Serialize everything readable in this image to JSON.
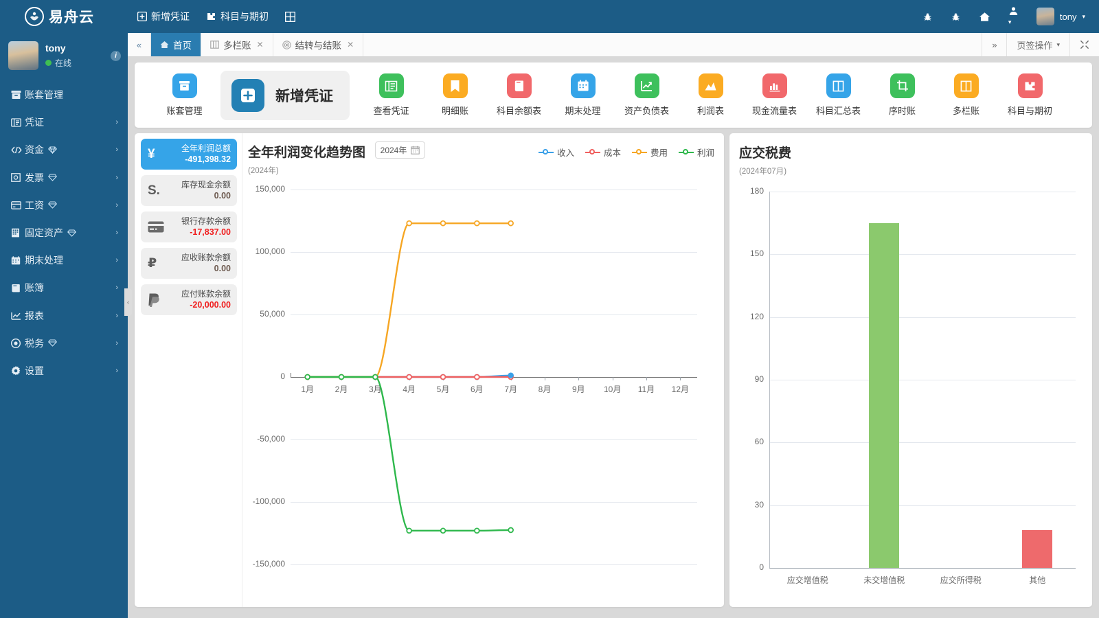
{
  "app": {
    "brand": "易舟云",
    "logo_icon": "lotus-logo-icon"
  },
  "topbar": {
    "actions": [
      {
        "label": "新增凭证",
        "icon": "plus-square-icon"
      },
      {
        "label": "科目与期初",
        "icon": "puzzle-icon"
      },
      {
        "label": "",
        "icon": "grid-icon"
      }
    ],
    "right_icons": [
      "bug-icon",
      "bug-alt-icon",
      "home-icon",
      "user-switch-icon"
    ],
    "user": "tony"
  },
  "sidebar": {
    "user": {
      "name": "tony",
      "status": "在线",
      "info_icon": "info-icon",
      "avatar": "user-avatar"
    },
    "items": [
      {
        "label": "账套管理",
        "icon": "archive-icon",
        "arrow": false,
        "gem": false
      },
      {
        "label": "凭证",
        "icon": "voucher-icon",
        "arrow": true,
        "gem": false
      },
      {
        "label": "资金",
        "icon": "funds-icon",
        "arrow": true,
        "gem": true
      },
      {
        "label": "发票",
        "icon": "invoice-icon",
        "arrow": true,
        "gem": true
      },
      {
        "label": "工资",
        "icon": "salary-card-icon",
        "arrow": true,
        "gem": true
      },
      {
        "label": "固定资产",
        "icon": "building-icon",
        "arrow": true,
        "gem": true
      },
      {
        "label": "期末处理",
        "icon": "calendar-icon",
        "arrow": true,
        "gem": false
      },
      {
        "label": "账簿",
        "icon": "book-icon",
        "arrow": true,
        "gem": false
      },
      {
        "label": "报表",
        "icon": "chart-line-icon",
        "arrow": true,
        "gem": false
      },
      {
        "label": "税务",
        "icon": "tax-circle-icon",
        "arrow": true,
        "gem": true
      },
      {
        "label": "设置",
        "icon": "gear-icon",
        "arrow": true,
        "gem": false
      }
    ],
    "collapse_icon": "chevron-left-icon"
  },
  "tabstrip": {
    "nav_prev_icon": "double-chevron-left-icon",
    "tabs": [
      {
        "label": "首页",
        "icon": "home-icon",
        "active": true,
        "closable": false
      },
      {
        "label": "多栏账",
        "icon": "columns-icon",
        "active": false,
        "closable": true
      },
      {
        "label": "结转与结账",
        "icon": "circle-target-icon",
        "active": false,
        "closable": true
      }
    ],
    "nav_next_icon": "double-chevron-right-icon",
    "ops_label": "页签操作",
    "fullscreen_icon": "expand-icon"
  },
  "shortcuts": {
    "primary": {
      "label": "新增凭证",
      "icon": "plus-square-icon",
      "color": "#2380b4"
    },
    "items": [
      {
        "label": "账套管理",
        "icon": "archive-icon",
        "color": "#35a4e8"
      },
      {
        "label": "查看凭证",
        "icon": "voucher-icon",
        "color": "#3ec05c"
      },
      {
        "label": "明细账",
        "icon": "bookmark-icon",
        "color": "#fbab22"
      },
      {
        "label": "科目余额表",
        "icon": "book-red-icon",
        "color": "#f1686b"
      },
      {
        "label": "期末处理",
        "icon": "calendar-icon",
        "color": "#35a4e8"
      },
      {
        "label": "资产负债表",
        "icon": "chart-line-icon",
        "color": "#3ec05c"
      },
      {
        "label": "利润表",
        "icon": "area-chart-icon",
        "color": "#fbab22"
      },
      {
        "label": "现金流量表",
        "icon": "bar-chart-icon",
        "color": "#f1686b"
      },
      {
        "label": "科目汇总表",
        "icon": "columns-icon",
        "color": "#35a4e8"
      },
      {
        "label": "序时账",
        "icon": "crop-icon",
        "color": "#3ec05c"
      },
      {
        "label": "多栏账",
        "icon": "columns-icon",
        "color": "#fbab22"
      },
      {
        "label": "科目与期初",
        "icon": "puzzle-icon",
        "color": "#f1686b"
      }
    ]
  },
  "stats": [
    {
      "title": "全年利润总额",
      "value": "-491,398.32",
      "icon": "yuan-icon",
      "accent": true,
      "negative": true
    },
    {
      "title": "库存现金余额",
      "value": "0.00",
      "icon": "cash-s-icon",
      "accent": false,
      "negative": false
    },
    {
      "title": "银行存款余额",
      "value": "-17,837.00",
      "icon": "credit-card-icon",
      "accent": false,
      "negative": true
    },
    {
      "title": "应收账款余额",
      "value": "0.00",
      "icon": "ruble-icon",
      "accent": false,
      "negative": false
    },
    {
      "title": "应付账款余额",
      "value": "-20,000.00",
      "icon": "paypal-icon",
      "accent": false,
      "negative": true
    }
  ],
  "line_panel": {
    "title": "全年利润变化趋势图",
    "subtitle": "(2024年)",
    "year_value": "2024年",
    "year_icon": "calendar-icon"
  },
  "bar_panel": {
    "title": "应交税费",
    "subtitle": "(2024年07月)"
  },
  "chart_data": [
    {
      "type": "line",
      "title": "全年利润变化趋势图",
      "subtitle": "(2024年)",
      "xlabel": "",
      "ylabel": "",
      "ylim": [
        -150000,
        150000
      ],
      "yticks": [
        150000,
        100000,
        50000,
        0,
        -50000,
        -100000,
        -150000
      ],
      "ytick_labels": [
        "150,000",
        "100,000",
        "50,000",
        "0",
        "-50,000",
        "-100,000",
        "-150,000"
      ],
      "categories": [
        "1月",
        "2月",
        "3月",
        "4月",
        "5月",
        "6月",
        "7月",
        "8月",
        "9月",
        "10月",
        "11月",
        "12月"
      ],
      "grid": true,
      "legend_position": "top-right",
      "series": [
        {
          "name": "收入",
          "color": "#3aa0e8",
          "values": [
            0,
            0,
            0,
            0,
            0,
            0,
            1200,
            null,
            null,
            null,
            null,
            null
          ]
        },
        {
          "name": "成本",
          "color": "#f0605f",
          "values": [
            0,
            0,
            0,
            0,
            0,
            0,
            0,
            null,
            null,
            null,
            null,
            null
          ]
        },
        {
          "name": "费用",
          "color": "#f6a623",
          "values": [
            0,
            0,
            0,
            123000,
            123000,
            123000,
            123000,
            null,
            null,
            null,
            null,
            null
          ]
        },
        {
          "name": "利润",
          "color": "#2eb84c",
          "values": [
            0,
            0,
            0,
            -123000,
            -123000,
            -123000,
            -122500,
            null,
            null,
            null,
            null,
            null
          ]
        }
      ]
    },
    {
      "type": "bar",
      "title": "应交税费",
      "subtitle": "(2024年07月)",
      "xlabel": "",
      "ylabel": "",
      "ylim": [
        0,
        180
      ],
      "yticks": [
        180,
        150,
        120,
        90,
        60,
        30,
        0
      ],
      "ytick_labels": [
        "180",
        "150",
        "120",
        "90",
        "60",
        "30",
        "0"
      ],
      "grid": true,
      "categories": [
        "应交增值税",
        "未交增值税",
        "应交所得税",
        "其他"
      ],
      "values": [
        0,
        165,
        0,
        18
      ],
      "colors": [
        "#8bc96d",
        "#8bc96d",
        "#8bc96d",
        "#ee6a6c"
      ]
    }
  ]
}
